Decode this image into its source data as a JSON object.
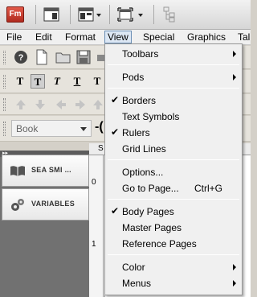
{
  "app": {
    "logo_text": "Fm"
  },
  "menubar": [
    "File",
    "Edit",
    "Format",
    "View",
    "Special",
    "Graphics",
    "Tal"
  ],
  "toolbar": {
    "paragraph_style": "Book"
  },
  "pods": [
    {
      "label": "SEA SMI ...",
      "icon": "book-icon"
    },
    {
      "label": "VARIABLES",
      "icon": "gears-icon"
    }
  ],
  "ruler": {
    "mark0": "0",
    "mark1": "1",
    "col_s": "S"
  },
  "view_menu": {
    "toolbars": "Toolbars",
    "pods": "Pods",
    "borders": "Borders",
    "text_symbols": "Text Symbols",
    "rulers": "Rulers",
    "grid_lines": "Grid Lines",
    "options": "Options...",
    "goto_page": "Go to Page...",
    "goto_shortcut": "Ctrl+G",
    "body_pages": "Body Pages",
    "master_pages": "Master Pages",
    "reference_pages": "Reference Pages",
    "color": "Color",
    "menus": "Menus"
  },
  "checks": {
    "borders": "✔",
    "rulers": "✔",
    "body_pages": "✔"
  },
  "colors": {
    "menu_highlight": "#dce7f4",
    "logo": "#c8382a"
  }
}
